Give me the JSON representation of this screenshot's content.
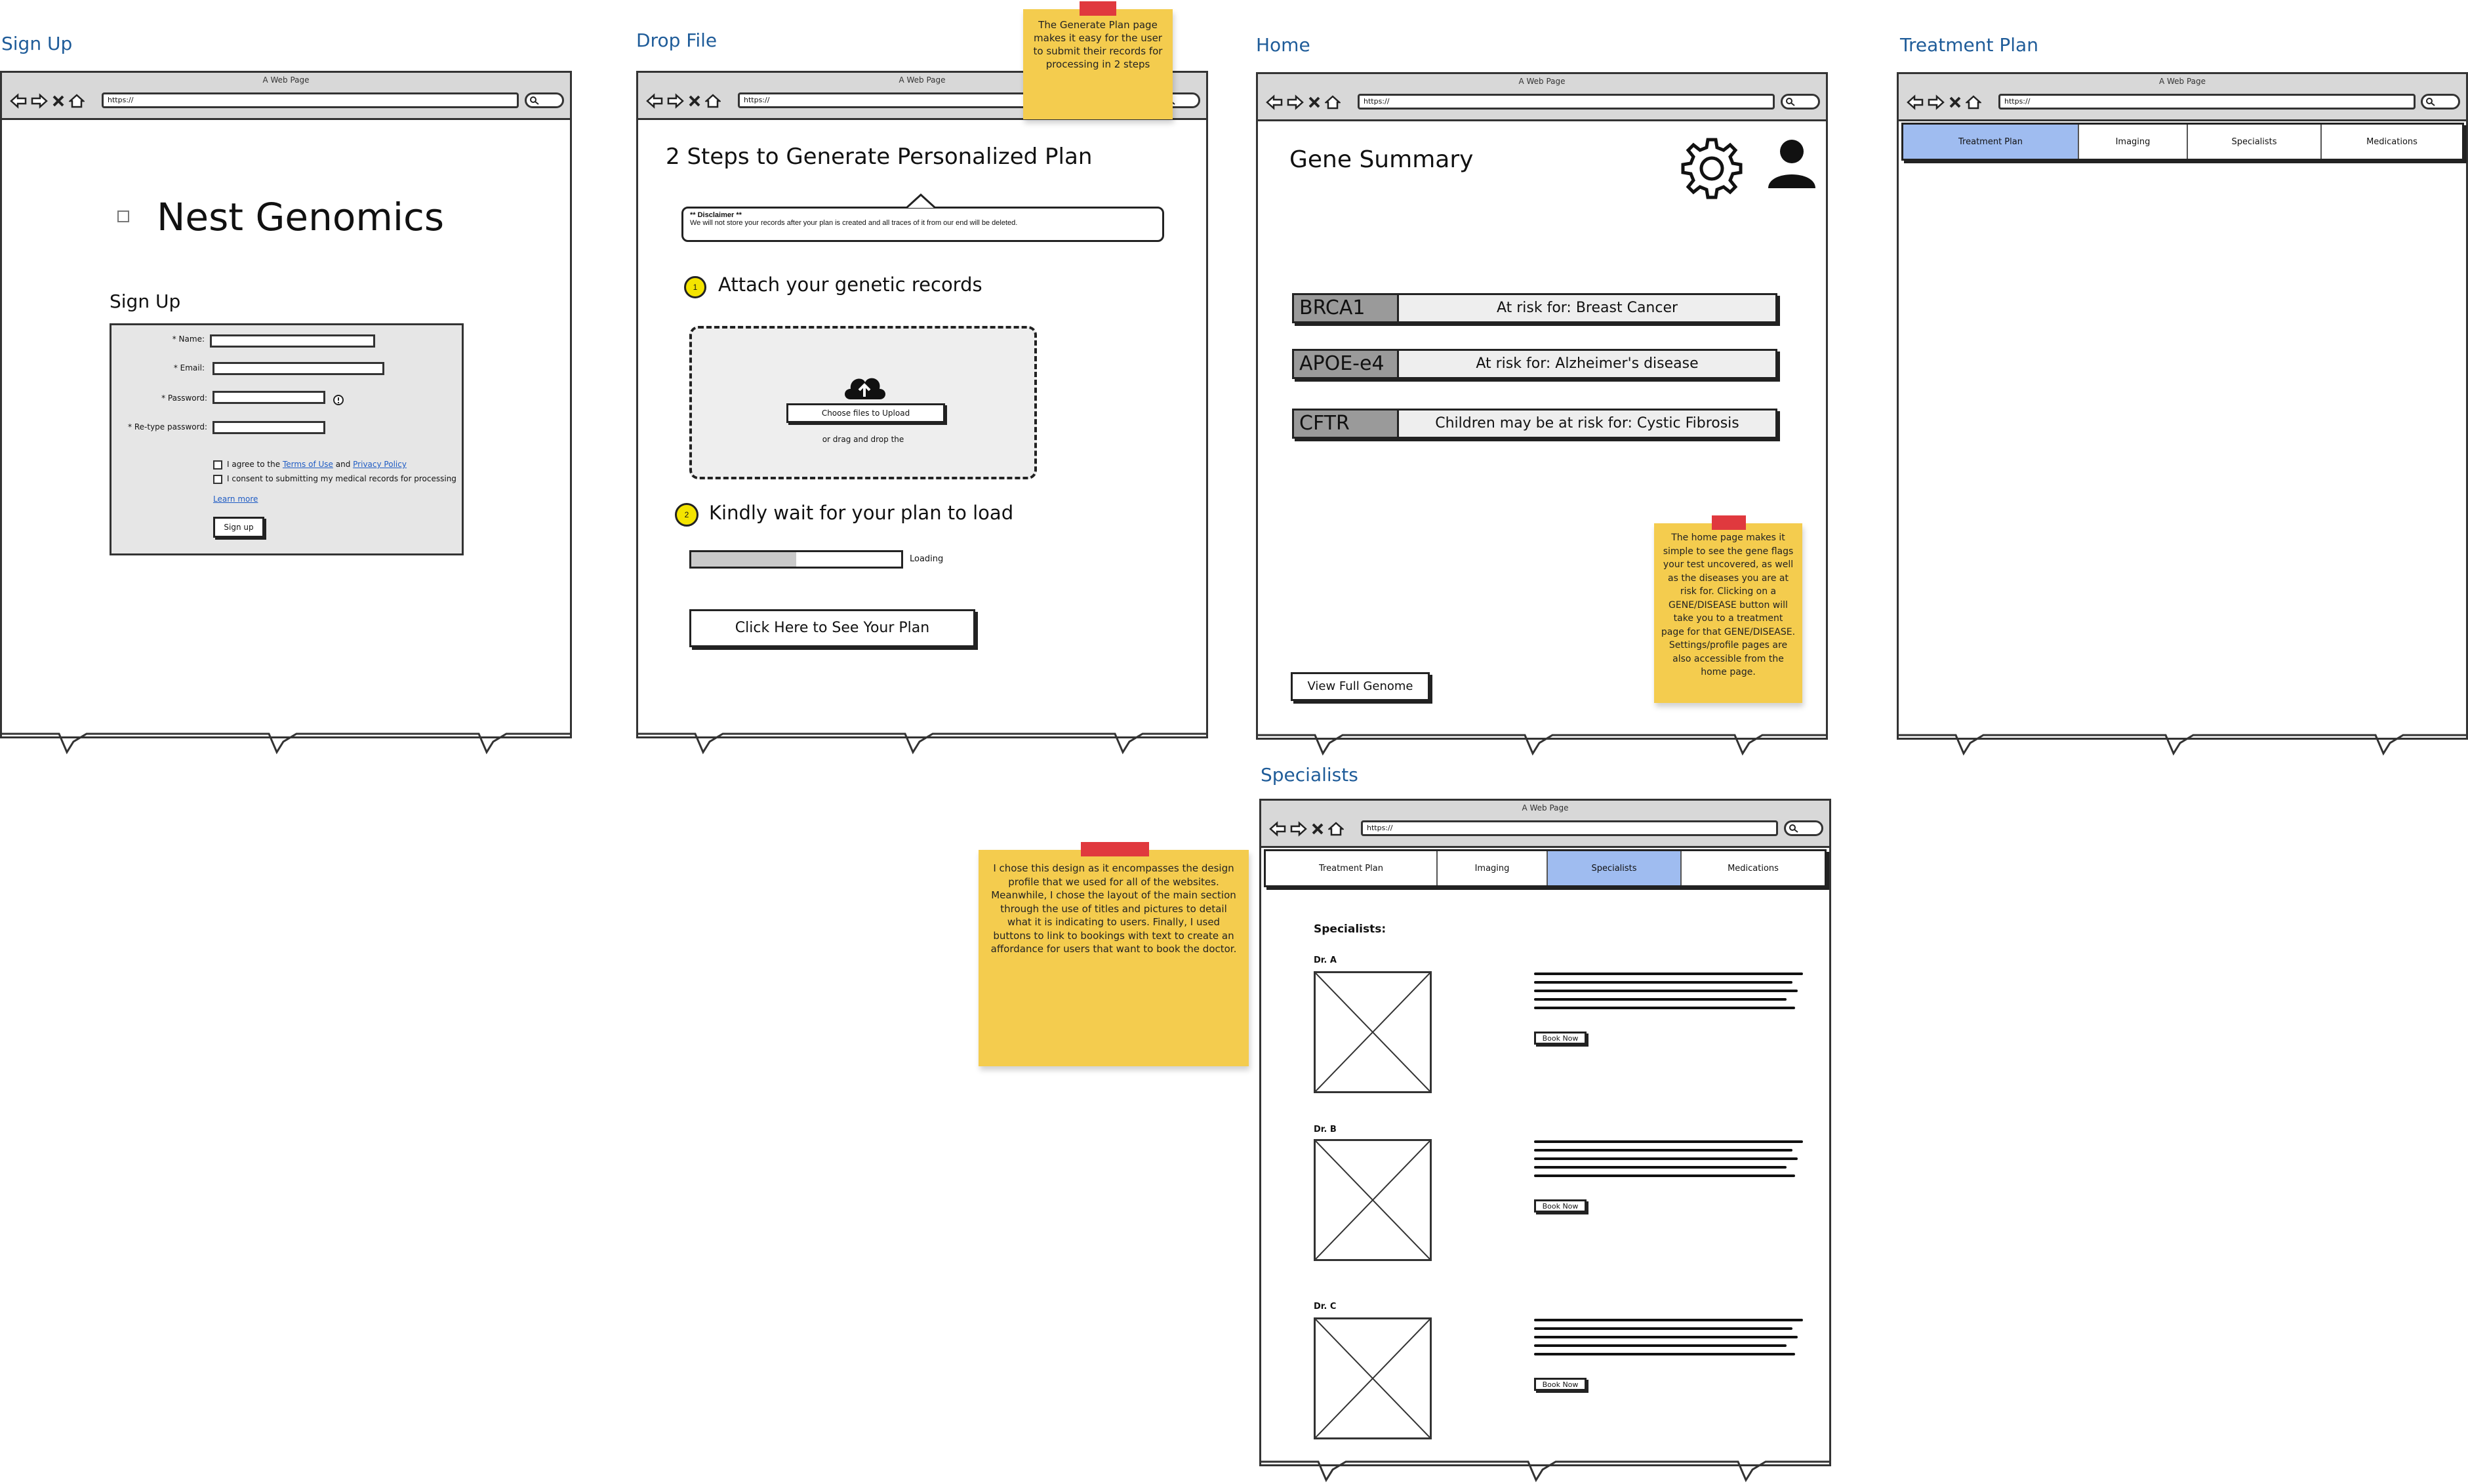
{
  "frames": {
    "signup": "Sign Up",
    "dropfile": "Drop File",
    "home": "Home",
    "treatment": "Treatment Plan",
    "specialists": "Specialists"
  },
  "window_title": "A Web Page",
  "url": "https://",
  "signup": {
    "brand": "Nest Genomics",
    "heading": "Sign Up",
    "fields": {
      "name": "* Name:",
      "email": "* Email:",
      "password": "* Password:",
      "retype": "* Re-type password:"
    },
    "agree_prefix": "I agree to the",
    "terms": "Terms of Use",
    "and": "and",
    "privacy": "Privacy Policy",
    "consent": "I consent to submitting my medical records for processing",
    "learn_more": "Learn more",
    "submit": "Sign up"
  },
  "dropfile": {
    "title": "2 Steps to Generate Personalized Plan",
    "disclaimer_title": "** Disclaimer **",
    "disclaimer_text": "We will not store your records after your plan is created and all traces of it from our end will be deleted.",
    "step1_num": "1",
    "step1": "Attach your genetic records",
    "upload_button": "Choose files to Upload",
    "drag_text": "or drag and drop the",
    "step2_num": "2",
    "step2": "Kindly wait for your plan to load",
    "progress": 0.5,
    "loading": "Loading",
    "cta": "Click Here to See Your Plan",
    "note": "The Generate Plan page makes it easy for the user to submit their records for processing in 2 steps"
  },
  "home": {
    "title": "Gene Summary",
    "genes": [
      {
        "name": "BRCA1",
        "risk": "At risk for: Breast Cancer"
      },
      {
        "name": "APOE-e4",
        "risk": "At risk for: Alzheimer's disease"
      },
      {
        "name": "CFTR",
        "risk": "Children may be at risk for: Cystic Fibrosis"
      }
    ],
    "view_full": "View Full Genome",
    "note": "The home page makes it simple to see the gene flags your test uncovered, as well as the diseases you are at risk for. Clicking on a GENE/DISEASE button will take you to a treatment page for that GENE/DISEASE. Settings/profile pages are also accessible from the home page."
  },
  "tabs": [
    "Treatment Plan",
    "Imaging",
    "Specialists",
    "Medications"
  ],
  "specialists": {
    "heading": "Specialists:",
    "doctors": [
      {
        "name": "Dr. A",
        "book": "Book Now"
      },
      {
        "name": "Dr. B",
        "book": "Book Now"
      },
      {
        "name": "Dr. C",
        "book": "Book Now"
      }
    ]
  },
  "design_note": "I chose this design as it encompasses the design profile that we used for all of the websites. Meanwhile, I chose the layout of the main section through the use of titles and pictures to detail what it is indicating to users. Finally, I used buttons to link to bookings with text to create an affordance for users that want to book the doctor.",
  "colors": {
    "frame_label": "#1f5c99",
    "sticky": "#f4cc4e",
    "tape": "#e0393e",
    "active_tab": "#9fbcf0"
  }
}
